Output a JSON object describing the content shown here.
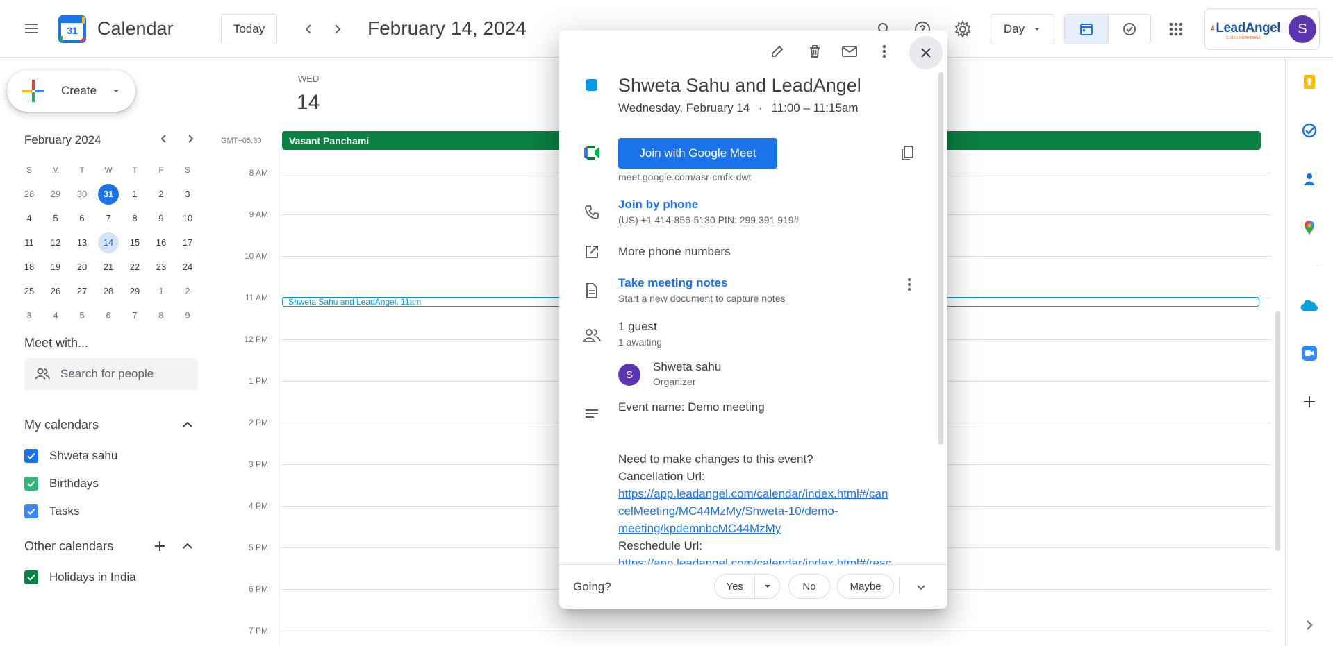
{
  "header": {
    "app_name": "Calendar",
    "logo_day": "31",
    "today_label": "Today",
    "date_title": "February 14, 2024",
    "view_label": "Day",
    "account_initial": "S",
    "brand_name": "LeadAngel",
    "brand_tagline": "CLOSE MORE DEALS"
  },
  "sidebar": {
    "create_label": "Create",
    "mini_calendar": {
      "month_label": "February 2024",
      "weekdays": [
        "S",
        "M",
        "T",
        "W",
        "T",
        "F",
        "S"
      ],
      "weeks": [
        [
          "28",
          "29",
          "30",
          "31",
          "1",
          "2",
          "3"
        ],
        [
          "4",
          "5",
          "6",
          "7",
          "8",
          "9",
          "10"
        ],
        [
          "11",
          "12",
          "13",
          "14",
          "15",
          "16",
          "17"
        ],
        [
          "18",
          "19",
          "20",
          "21",
          "22",
          "23",
          "24"
        ],
        [
          "25",
          "26",
          "27",
          "28",
          "29",
          "1",
          "2"
        ],
        [
          "3",
          "4",
          "5",
          "6",
          "7",
          "8",
          "9"
        ]
      ]
    },
    "meet_with_label": "Meet with...",
    "search_people_placeholder": "Search for people",
    "my_calendars_label": "My calendars",
    "my_calendars": [
      {
        "name": "Shweta sahu",
        "color": "#1a73e8"
      },
      {
        "name": "Birthdays",
        "color": "#33b679"
      },
      {
        "name": "Tasks",
        "color": "#4285f4"
      }
    ],
    "other_calendars_label": "Other calendars",
    "other_calendars": [
      {
        "name": "Holidays in India",
        "color": "#0b8043"
      }
    ]
  },
  "day_view": {
    "weekday": "WED",
    "day_number": "14",
    "timezone": "GMT+05:30",
    "all_day_event": "Vasant Panchami",
    "hours": [
      "8 AM",
      "9 AM",
      "10 AM",
      "11 AM",
      "12 PM",
      "1 PM",
      "2 PM",
      "3 PM",
      "4 PM",
      "5 PM",
      "6 PM",
      "7 PM"
    ],
    "event_chip": "Shweta Sahu and LeadAngel, 11am"
  },
  "popup": {
    "title": "Shweta Sahu and LeadAngel",
    "event_color": "#039be5",
    "date_line": "Wednesday, February 14",
    "time_line": "11:00 – 11:15am",
    "join_button": "Join with Google Meet",
    "meet_link": "meet.google.com/asr-cmfk-dwt",
    "join_phone": "Join by phone",
    "phone_details": "(US) +1 414-856-5130 PIN: 299 391 919#",
    "more_phone": "More phone numbers",
    "notes_title": "Take meeting notes",
    "notes_sub": "Start a new document to capture notes",
    "guest_count": "1 guest",
    "guest_status": "1 awaiting",
    "guest_initial": "S",
    "guest_name": "Shweta sahu",
    "guest_role": "Organizer",
    "description": {
      "event_name": "Event name: Demo meeting",
      "changes": "Need to make changes to this event?",
      "cancel_label": "Cancellation Url:",
      "cancel_url_1": "https://app.leadangel.com/calendar/index.html#/can",
      "cancel_url_2": "celMeeting/MC44MzMy/Shweta-10/demo-",
      "cancel_url_3": "meeting/kpdemnbcMC44MzMy",
      "resched_label": "Reschedule Url:",
      "resched_url_1": "https://app.leadangel.com/calendar/index.html#/resc"
    },
    "going_label": "Going?",
    "yes_label": "Yes",
    "no_label": "No",
    "maybe_label": "Maybe"
  }
}
